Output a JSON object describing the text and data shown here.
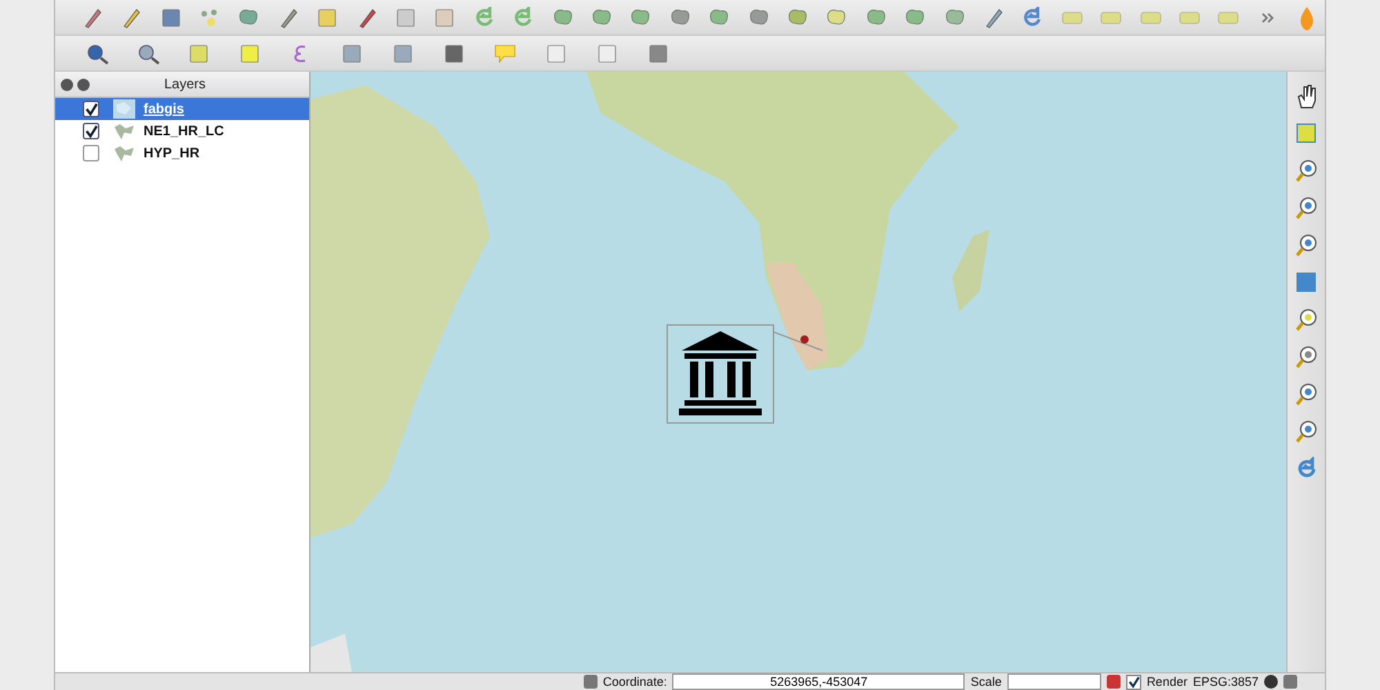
{
  "layers_panel": {
    "title": "Layers",
    "layers": [
      {
        "name": "fabgis",
        "checked": true,
        "selected": true,
        "kind": "vector"
      },
      {
        "name": "NE1_HR_LC",
        "checked": true,
        "selected": false,
        "kind": "raster"
      },
      {
        "name": "HYP_HR",
        "checked": false,
        "selected": false,
        "kind": "raster"
      }
    ]
  },
  "status_bar": {
    "coordinate_label": "Coordinate:",
    "coordinate_value": "5263965,-453047",
    "scale_label": "Scale",
    "render_label": "Render",
    "render_checked": true,
    "crs": "EPSG:3857"
  }
}
